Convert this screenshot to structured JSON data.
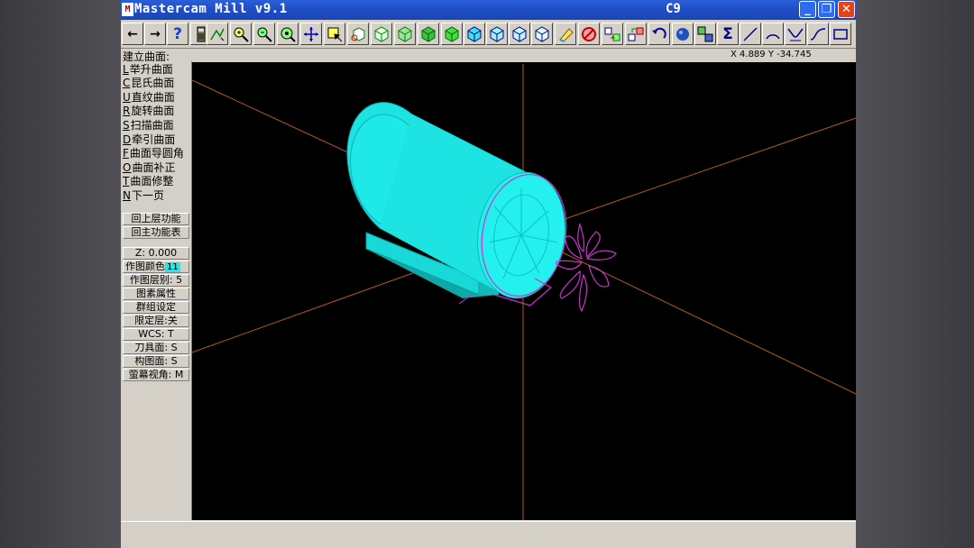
{
  "window": {
    "title": "Mastercam Mill v9.1",
    "title_right": "C9",
    "app_icon": "M",
    "buttons": {
      "minimize": "_",
      "maximize": "❐",
      "close": "✕"
    }
  },
  "toolbar": {
    "back": "←",
    "forward": "→",
    "help": "?",
    "icons": [
      "back-arrow-icon",
      "forward-arrow-icon",
      "help-icon",
      "calculator-icon",
      "autocursor-icon",
      "zoom-window-icon",
      "zoom-out-icon",
      "zoom-fit-icon",
      "pan-icon",
      "select-icon",
      "rotate-icon",
      "view-top-icon",
      "view-front-icon",
      "view-side-icon",
      "view-iso-icon",
      "cube-1-icon",
      "cube-2-icon",
      "cube-3-icon",
      "cube-4-icon",
      "eraser-icon",
      "no-delete-icon",
      "transform-1-icon",
      "transform-2-icon",
      "undo-icon",
      "shade-sphere-icon",
      "analyze-icon",
      "sum-icon",
      "line-icon",
      "arc-icon",
      "fillet-icon",
      "spline-icon",
      "rectangle-icon"
    ]
  },
  "prompt": "建立曲面:",
  "coords": "X 4.889  Y -34.745",
  "menu": {
    "items": [
      {
        "key": "L",
        "label": "举升曲面"
      },
      {
        "key": "C",
        "label": "昆氏曲面"
      },
      {
        "key": "U",
        "label": "直纹曲面"
      },
      {
        "key": "R",
        "label": "旋转曲面"
      },
      {
        "key": "S",
        "label": "扫描曲面"
      },
      {
        "key": "D",
        "label": "牵引曲面"
      },
      {
        "key": "F",
        "label": "曲面导圆角"
      },
      {
        "key": "O",
        "label": "曲面补正"
      },
      {
        "key": "T",
        "label": "曲面修整"
      },
      {
        "key": "N",
        "label": "下一页"
      }
    ],
    "back_upper": "回上层功能",
    "back_main": "回主功能表",
    "status": {
      "z": "Z:  0.000",
      "color_label": "作图颜色",
      "color_value": "11",
      "level": "作图层别: 5",
      "attributes": "图素属性",
      "group": "群组设定",
      "limit": "限定层:关",
      "wcs": "WCS:  T",
      "tplane": "刀具面: S",
      "cplane": "构图面: S",
      "gview": "萤幕视角: M"
    }
  },
  "colors": {
    "titlebar": "#1f4fc8",
    "surface_cyan": "#19ecec",
    "axis_orange": "#b4581c",
    "geometry_magenta": "#cc33cc",
    "viewport_bg": "#000000"
  }
}
